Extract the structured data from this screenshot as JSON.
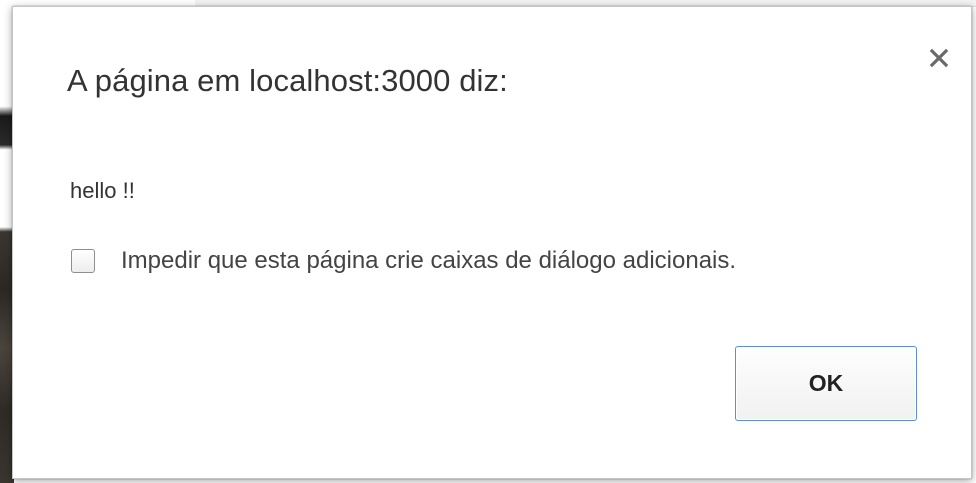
{
  "dialog": {
    "title": "A página em localhost:3000 diz:",
    "message": "hello !!",
    "suppress_checkbox": {
      "label": "Impedir que esta página crie caixas de diálogo adicionais.",
      "checked": false
    },
    "ok_label": "OK",
    "close_icon": "close-icon"
  },
  "colors": {
    "dialog_background": "#ffffff",
    "title_text": "#333333",
    "ok_border_focus": "#5a8fe0"
  }
}
